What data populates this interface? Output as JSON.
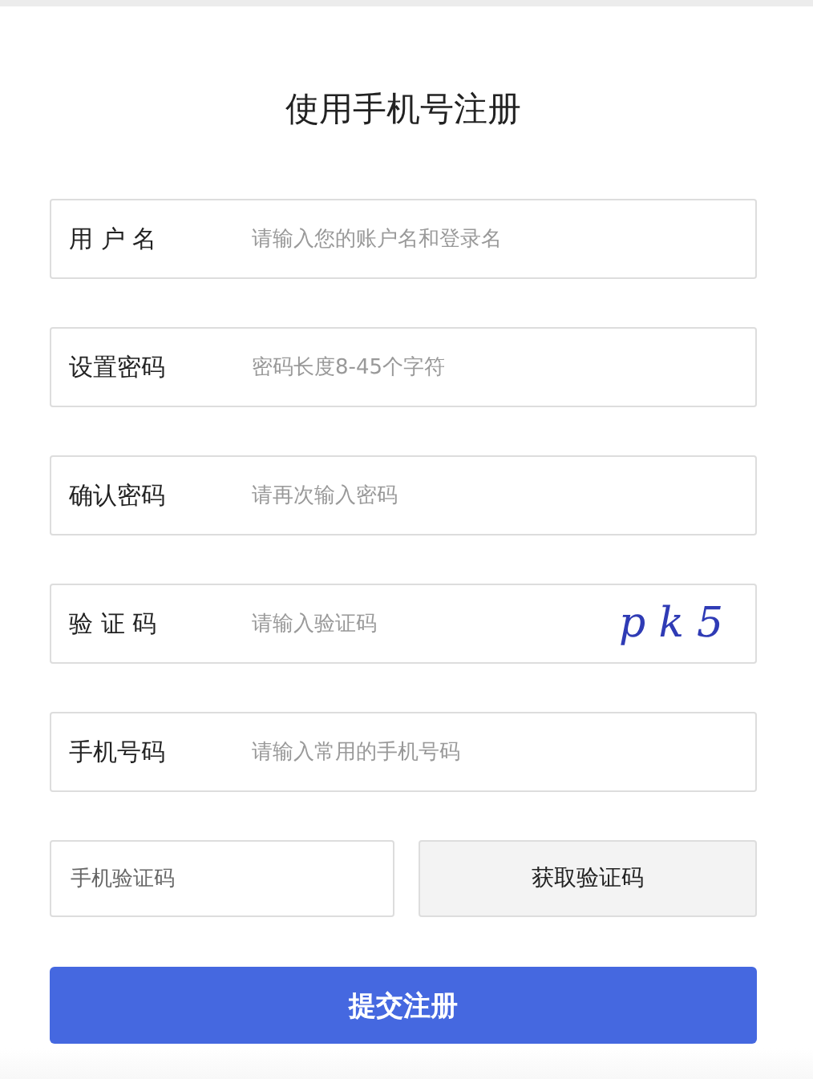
{
  "title": "使用手机号注册",
  "fields": [
    {
      "label": "用 户 名",
      "placeholder": "请输入您的账户名和登录名"
    },
    {
      "label": "设置密码",
      "placeholder": "密码长度8-45个字符"
    },
    {
      "label": "确认密码",
      "placeholder": "请再次输入密码"
    },
    {
      "label": "验 证 码",
      "placeholder": "请输入验证码",
      "captcha": "pk5"
    },
    {
      "label": "手机号码",
      "placeholder": "请输入常用的手机号码"
    }
  ],
  "sms_code": {
    "placeholder": "手机验证码",
    "button": "获取验证码"
  },
  "submit": "提交注册"
}
